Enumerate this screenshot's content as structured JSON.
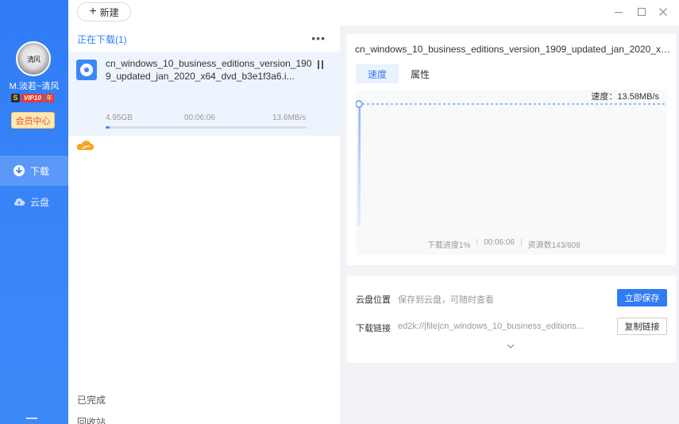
{
  "user": {
    "name": "M.淡若~清风",
    "avatar_text": "清风",
    "vip_prefix": "S",
    "vip_label": "VIP10",
    "vip_suffix": "年",
    "member_center": "会员中心"
  },
  "nav": {
    "download": "下载",
    "cloud": "云盘"
  },
  "toolbar": {
    "new_label": "新建"
  },
  "list": {
    "section_title": "正在下载(1)",
    "more_icon": "more-horizontal-icon",
    "tasks": [
      {
        "name": "cn_windows_10_business_editions_version_1909_updated_jan_2020_x64_dvd_b3e1f3a6.i...",
        "size": "4.95GB",
        "elapsed": "00:06:06",
        "speed": "13.6MB/s",
        "progress": 0.01
      }
    ],
    "finished": "已完成",
    "recycle": "回收站"
  },
  "detail": {
    "title": "cn_windows_10_business_editions_version_1909_updated_jan_2020_x64_dvd...",
    "tabs": {
      "speed": "速度",
      "props": "属性"
    },
    "speed_label": "速度：13.58MB/s",
    "progress_text": "下载进度1%",
    "elapsed": "00:06:06",
    "sources": "资源数143/608"
  },
  "cloud": {
    "location_label": "云盘位置",
    "location_hint": "保存到云盘，可随时查看",
    "save_button": "立即保存",
    "link_label": "下载链接",
    "link_value": "ed2k://|file|cn_windows_10_business_editions...",
    "copy_button": "复制链接"
  },
  "colors": {
    "accent": "#2f7cf6",
    "sidebar": "#3a86f7",
    "selected_row": "#eef4fe"
  },
  "chart_data": {
    "type": "line",
    "title": "",
    "series": [
      {
        "values": [
          0,
          13.58,
          13.58
        ]
      }
    ],
    "current_speed_mbps": 13.58
  }
}
